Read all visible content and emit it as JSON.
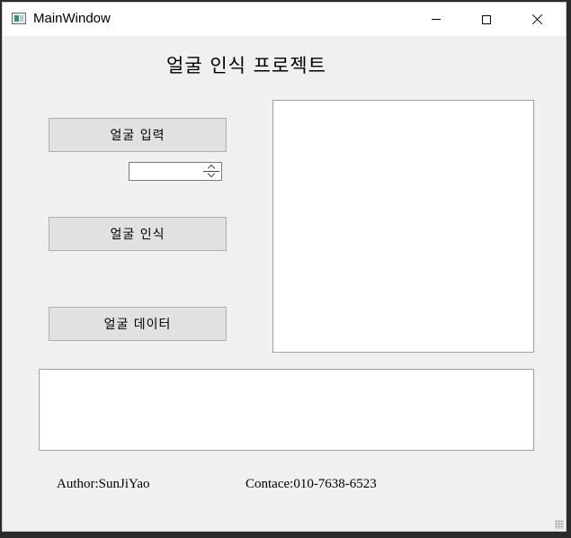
{
  "window": {
    "title": "MainWindow",
    "controls": {
      "minimize_icon": "minimize-icon",
      "maximize_icon": "maximize-icon",
      "close_icon": "close-icon"
    }
  },
  "main": {
    "heading": "얼굴 인식 프로젝트",
    "buttons": {
      "face_input": "얼굴 입력",
      "face_recognition": "얼굴 인식",
      "face_data": "얼굴 데이터"
    },
    "spinbox": {
      "value": ""
    },
    "footer": {
      "author": "Author:SunJiYao",
      "contact": "Contace:010-7638-6523"
    }
  },
  "colors": {
    "window_bg": "#f0f0f0",
    "titlebar_bg": "#ffffff",
    "button_bg": "#e1e1e1",
    "button_border": "#adadad"
  }
}
